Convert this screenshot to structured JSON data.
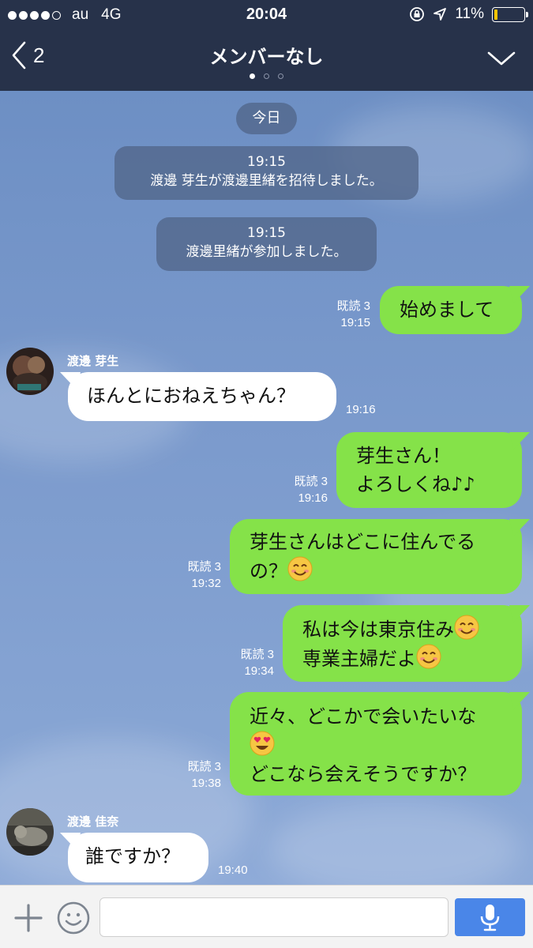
{
  "status_bar": {
    "carrier": "au",
    "network": "4G",
    "time": "20:04",
    "battery": "11%",
    "battery_level": 0.11,
    "icons": [
      "signal-dots-icon",
      "rotation-lock-icon",
      "location-arrow-icon",
      "battery-icon"
    ]
  },
  "header": {
    "back_count": "2",
    "title": "メンバーなし",
    "page_count": 3,
    "active_page": 1
  },
  "chat": {
    "date_label": "今日",
    "system_messages": [
      {
        "time": "19:15",
        "text": "渡邊 芽生が渡邊里緒を招待しました。"
      },
      {
        "time": "19:15",
        "text": "渡邊里緒が参加しました。"
      }
    ],
    "messages": [
      {
        "direction": "out",
        "lines": [
          "始めまして"
        ],
        "read": "既読 3",
        "time": "19:15"
      },
      {
        "direction": "in",
        "sender": "渡邊 芽生",
        "lines": [
          "ほんとにおねえちゃん？"
        ],
        "time": "19:16"
      },
      {
        "direction": "out",
        "lines": [
          "芽生さん！",
          "よろしくね♪♪"
        ],
        "read": "既読 3",
        "time": "19:16"
      },
      {
        "direction": "out",
        "lines": [
          "芽生さんはどこに住んでる",
          "の？"
        ],
        "read": "既読 3",
        "time": "19:32"
      },
      {
        "direction": "out",
        "lines": [
          "私は今は東京住み",
          "専業主婦だよ"
        ],
        "read": "既読 3",
        "time": "19:34"
      },
      {
        "direction": "out",
        "lines": [
          "近々、どこかで会いたいな",
          "",
          "どこなら会えそうですか？"
        ],
        "read": "既読 3",
        "time": "19:38"
      },
      {
        "direction": "in",
        "sender": "渡邊 佳奈",
        "lines": [
          "誰ですか？"
        ],
        "time": "19:40"
      }
    ],
    "emoji_names": [
      "smiling-face-emoji",
      "heart-eyes-emoji"
    ]
  },
  "input_bar": {
    "placeholder": "",
    "icons": [
      "plus-icon",
      "smiley-icon",
      "microphone-icon"
    ]
  },
  "colors": {
    "header_bg": "#27324a",
    "outgoing_bubble": "#85e249",
    "incoming_bubble": "#ffffff",
    "send_button": "#4a86e8",
    "battery_fill": "#f5c400"
  }
}
